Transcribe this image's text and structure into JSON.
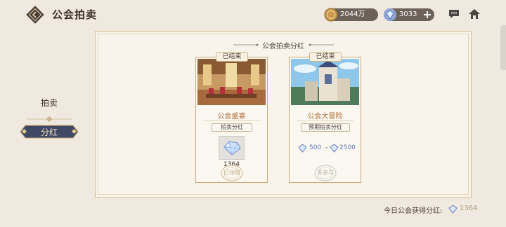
{
  "header": {
    "title": "公会拍卖",
    "gold": "2044万",
    "gems": "3033"
  },
  "nav": {
    "items": [
      {
        "label": "拍卖",
        "selected": false
      },
      {
        "label": "分红",
        "selected": true
      }
    ]
  },
  "panel": {
    "title": "公会拍卖分红",
    "cards": [
      {
        "status": "已结束",
        "name": "公会盛宴",
        "sub_label": "拍卖分红",
        "item_count": "1364",
        "stamp": "已领取"
      },
      {
        "status": "已结束",
        "name": "公会大冒险",
        "sub_label": "预期拍卖分红",
        "range_min": "500",
        "range_sep": "-",
        "range_max": "2500",
        "stamp": "未参与"
      }
    ]
  },
  "footer": {
    "label": "今日公会获得分红:",
    "value": "1364"
  },
  "colors": {
    "accent_gold": "#cda978",
    "nav_selected_bg": "#3f4864",
    "gem_blue": "#5a73b8"
  }
}
